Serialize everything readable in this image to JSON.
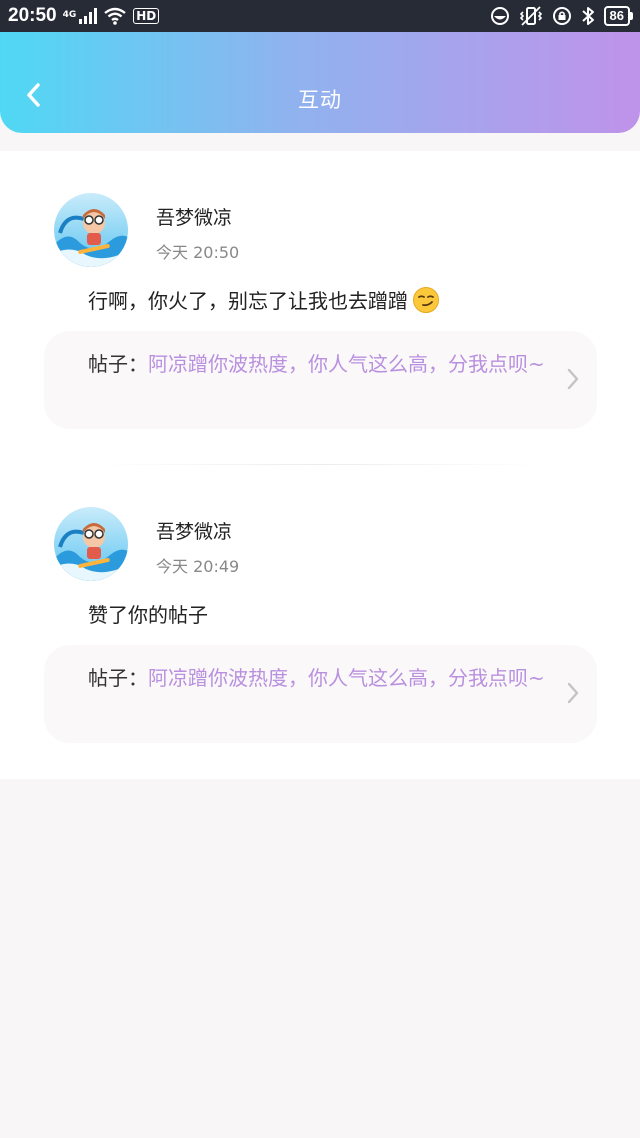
{
  "status_bar": {
    "time": "20:50",
    "network": "4G",
    "hd_label": "HD",
    "battery": "86"
  },
  "header": {
    "title": "互动",
    "gradient_start": "#4fd8f4",
    "gradient_end": "#bf93ea"
  },
  "notifications": [
    {
      "username": "吾梦微凉",
      "time": "今天 20:50",
      "message": "行啊，你火了，别忘了让我也去蹭蹭",
      "message_emoji": "smirk-emoji",
      "post_label": "帖子：",
      "post_title": "阿凉蹭你波热度，你人气这么高，分我点呗~"
    },
    {
      "username": "吾梦微凉",
      "time": "今天 20:49",
      "message": "赞了你的帖子",
      "post_label": "帖子：",
      "post_title": "阿凉蹭你波热度，你人气这么高，分我点呗~"
    }
  ],
  "colors": {
    "post_title": "#b990df",
    "page_background": "#f8f6f7"
  }
}
